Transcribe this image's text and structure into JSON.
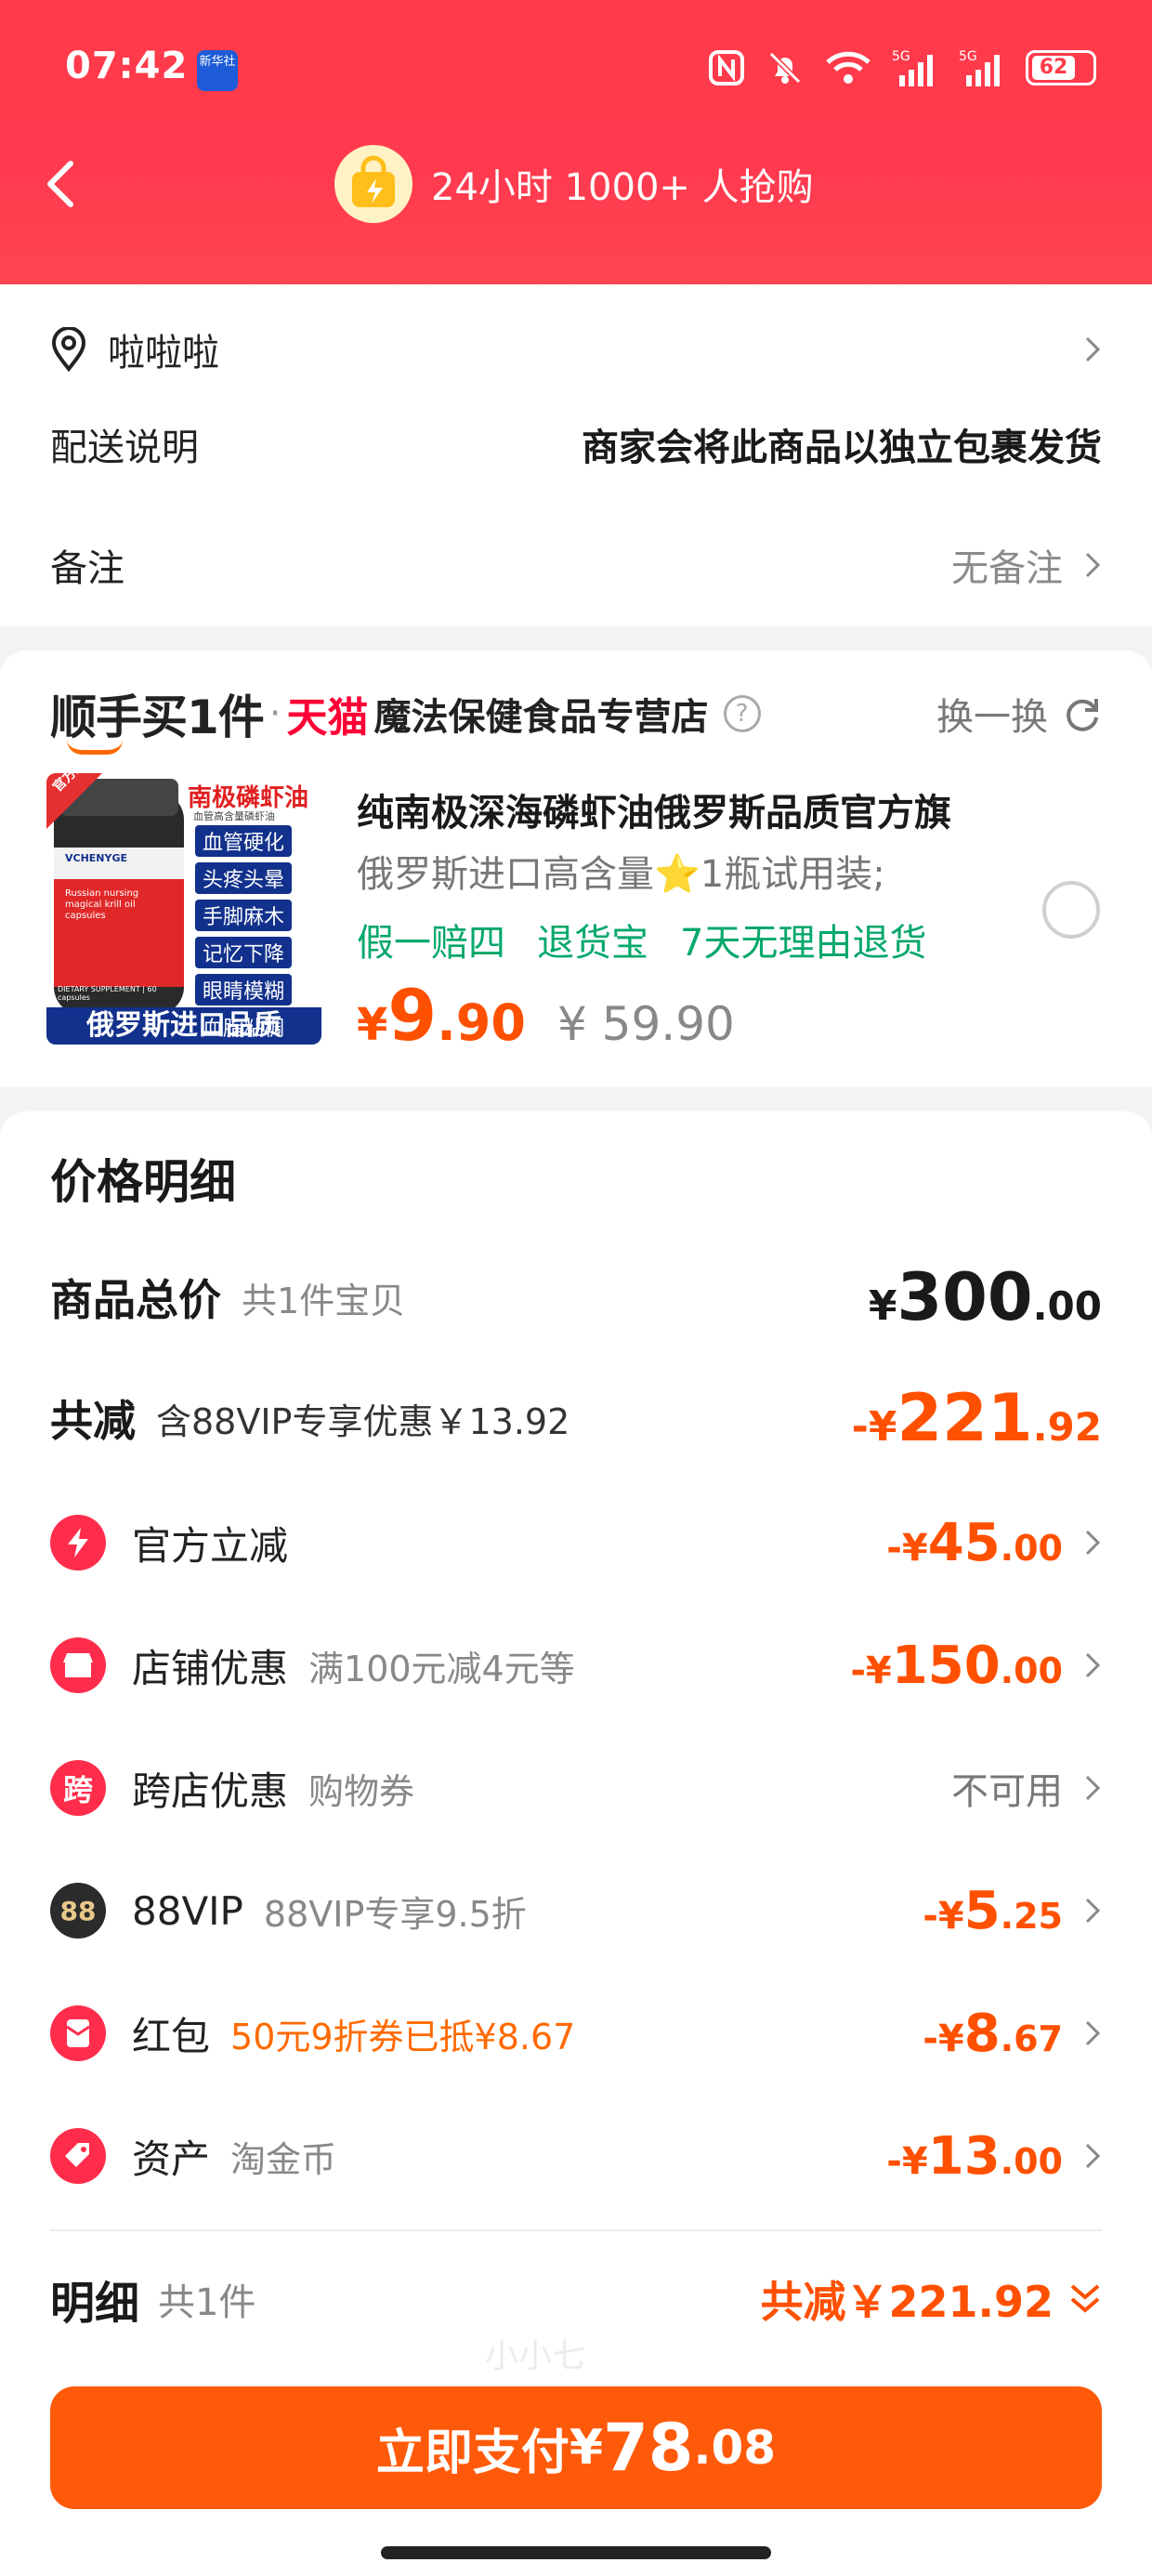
{
  "status_bar": {
    "time": "07:42",
    "news_badge": "新华社",
    "battery": "62"
  },
  "header": {
    "hot_text": "24小时 1000+ 人抢购"
  },
  "address": {
    "name": "啦啦啦",
    "delivery_label": "配送说明",
    "delivery_value": "商家会将此商品以独立包裹发货",
    "note_label": "备注",
    "note_value": "无备注"
  },
  "shop": {
    "brand": "顺手买1件",
    "dot": "·",
    "platform": "天猫",
    "name": "魔法保健食品专营店",
    "swap_label": "换一换"
  },
  "product": {
    "title": "纯南极深海磷虾油俄罗斯品质官方旗",
    "subtitle": "俄罗斯进口高含量⭐1瓶试用装;",
    "tags": [
      "假一赔四",
      "退货宝",
      "7天无理由退货"
    ],
    "price_currency": "¥",
    "price_int": "9",
    "price_dec": ".90",
    "original_price": "¥ 59.90",
    "image": {
      "badge": "官方正品",
      "heading": "南极磷虾油",
      "sub": "血管高含量磷虾油",
      "pills": [
        "血管硬化",
        "头疼头晕",
        "手脚麻木",
        "记忆下降",
        "眼睛模糊",
        "血脂粘稠"
      ],
      "bottom": "俄罗斯进口品质",
      "bottle_brand": "VCHENYGE",
      "bottle_text": "Russian nursing magical krill oil capsules",
      "bottle_footer": "DIETARY SUPPLEMENT | 60 capsules"
    }
  },
  "price_detail": {
    "title": "价格明细",
    "watermark": "小小七",
    "total": {
      "label": "商品总价",
      "sub": "共1件宝贝",
      "cur": "¥",
      "int": "300",
      "dec": ".00"
    },
    "reduce": {
      "label": "共减",
      "sub": "含88VIP专享优惠￥13.92",
      "cur": "-¥",
      "int": "221",
      "dec": ".92"
    },
    "items": [
      {
        "icon": "lightning-icon",
        "color": "#ff2d4b",
        "label": "官方立减",
        "sub": "",
        "cur": "-¥",
        "int": "45",
        "dec": ".00"
      },
      {
        "icon": "shop-icon",
        "color": "#ff2d4b",
        "label": "店铺优惠",
        "sub": "满100元减4元等",
        "cur": "-¥",
        "int": "150",
        "dec": ".00"
      },
      {
        "icon": "cross-shop-icon",
        "glyph": "跨",
        "color": "#ff2d4b",
        "label": "跨店优惠",
        "sub": "购物券",
        "status": "不可用"
      },
      {
        "icon": "vip-88-icon",
        "glyph": "88",
        "color": "#2b2b2b",
        "label": "88VIP",
        "sub": "88VIP专享9.5折",
        "cur": "-¥",
        "int": "5",
        "dec": ".25"
      },
      {
        "icon": "red-packet-icon",
        "color": "#ff2d4b",
        "label": "红包",
        "sub": "50元9折券已抵¥8.67",
        "cur": "-¥",
        "int": "8",
        "dec": ".67"
      },
      {
        "icon": "coin-tag-icon",
        "color": "#ff2d4b",
        "label": "资产",
        "sub": "淘金币",
        "cur": "-¥",
        "int": "13",
        "dec": ".00"
      }
    ],
    "summary": {
      "label": "明细",
      "sub": "共1件",
      "total": "共减￥221.92"
    },
    "pay": {
      "text": "立即支付",
      "cur": "¥",
      "int": "78",
      "dec": ".08"
    }
  }
}
